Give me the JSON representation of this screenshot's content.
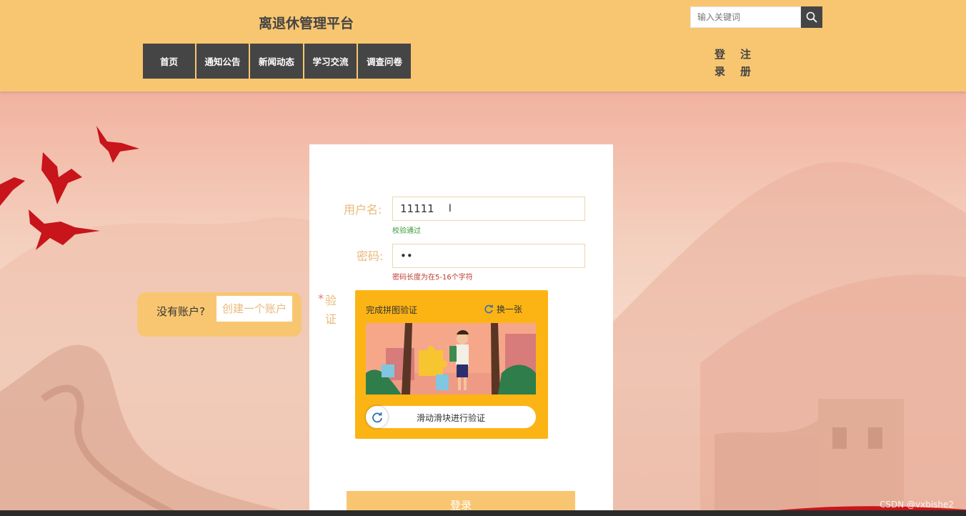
{
  "header": {
    "title": "离退休管理平台",
    "nav": [
      {
        "label": "首页"
      },
      {
        "label": "通知公告"
      },
      {
        "label": "新闻动态"
      },
      {
        "label": "学习交流"
      },
      {
        "label": "调查问卷"
      }
    ],
    "search": {
      "placeholder": "输入关键词"
    },
    "login_link": "登录",
    "register_link": "注册"
  },
  "login_form": {
    "username_label": "用户名:",
    "username_value": "11111",
    "username_hint": "校验通过",
    "password_label": "密码:",
    "password_value": "••",
    "password_hint": "密码长度为在5-16个字符",
    "captcha_required_mark": "*",
    "captcha_label": "验证",
    "captcha": {
      "title": "完成拼图验证",
      "refresh_label": "换一张",
      "slider_text": "滑动滑块进行验证"
    },
    "submit_label": "登录"
  },
  "signup_prompt": {
    "text": "没有账户?",
    "button_label": "创建一个账户"
  },
  "watermark": "CSDN @vxbishe2",
  "colors": {
    "accent": "#f8c671",
    "nav_bg": "#454545",
    "captcha_bg": "#fcb414",
    "label": "#e9b97a",
    "success": "#3a9a3a",
    "error": "#c0392b"
  }
}
